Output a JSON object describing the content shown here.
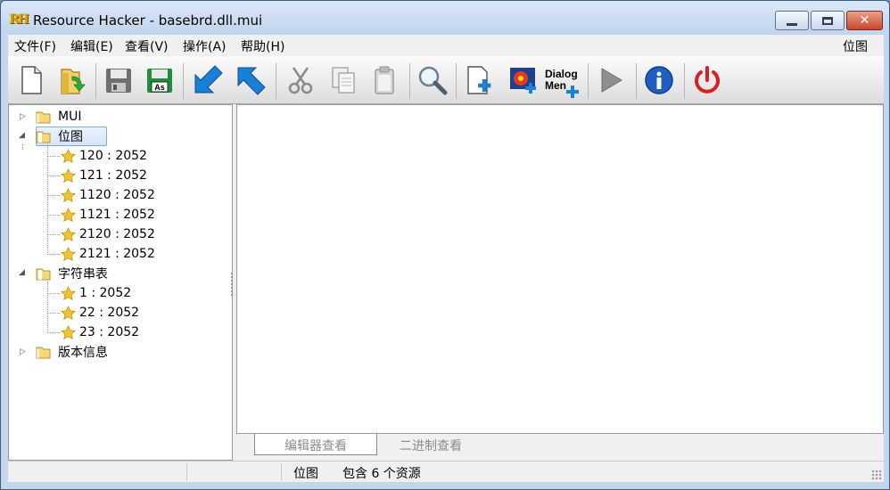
{
  "window": {
    "title": "Resource Hacker - basebrd.dll.mui",
    "app_icon": "RH"
  },
  "menu": {
    "items": [
      "文件(F)",
      "编辑(E)",
      "查看(V)",
      "操作(A)",
      "帮助(H)"
    ],
    "right_label": "位图"
  },
  "toolbar": {
    "icons": [
      "new-file-icon",
      "open-folder-icon",
      "save-icon",
      "save-as-icon",
      "arrow-down-left-icon",
      "arrow-up-left-icon",
      "cut-icon",
      "copy-icon",
      "paste-icon",
      "search-icon",
      "add-resource-icon",
      "add-image-icon",
      "add-dialog-menu-icon",
      "play-icon",
      "info-icon",
      "power-icon"
    ],
    "save_as_label": "As",
    "dialog_label_1": "Dialog",
    "dialog_label_2": "Men"
  },
  "tree": {
    "mui": "MUI",
    "bitmap": "位图",
    "bitmap_items": [
      "120 : 2052",
      "121 : 2052",
      "1120 : 2052",
      "1121 : 2052",
      "2120 : 2052",
      "2121 : 2052"
    ],
    "string_table": "字符串表",
    "string_items": [
      "1 : 2052",
      "22 : 2052",
      "23 : 2052"
    ],
    "version_info": "版本信息"
  },
  "tabs": {
    "editor_view": "编辑器查看",
    "binary_view": "二进制查看"
  },
  "status": {
    "type": "位图",
    "summary": "包含 6 个资源"
  },
  "colors": {
    "accent_blue": "#1a7fd6",
    "power_red": "#d92020",
    "star": "#f2c230",
    "folder": "#f5d97a"
  }
}
